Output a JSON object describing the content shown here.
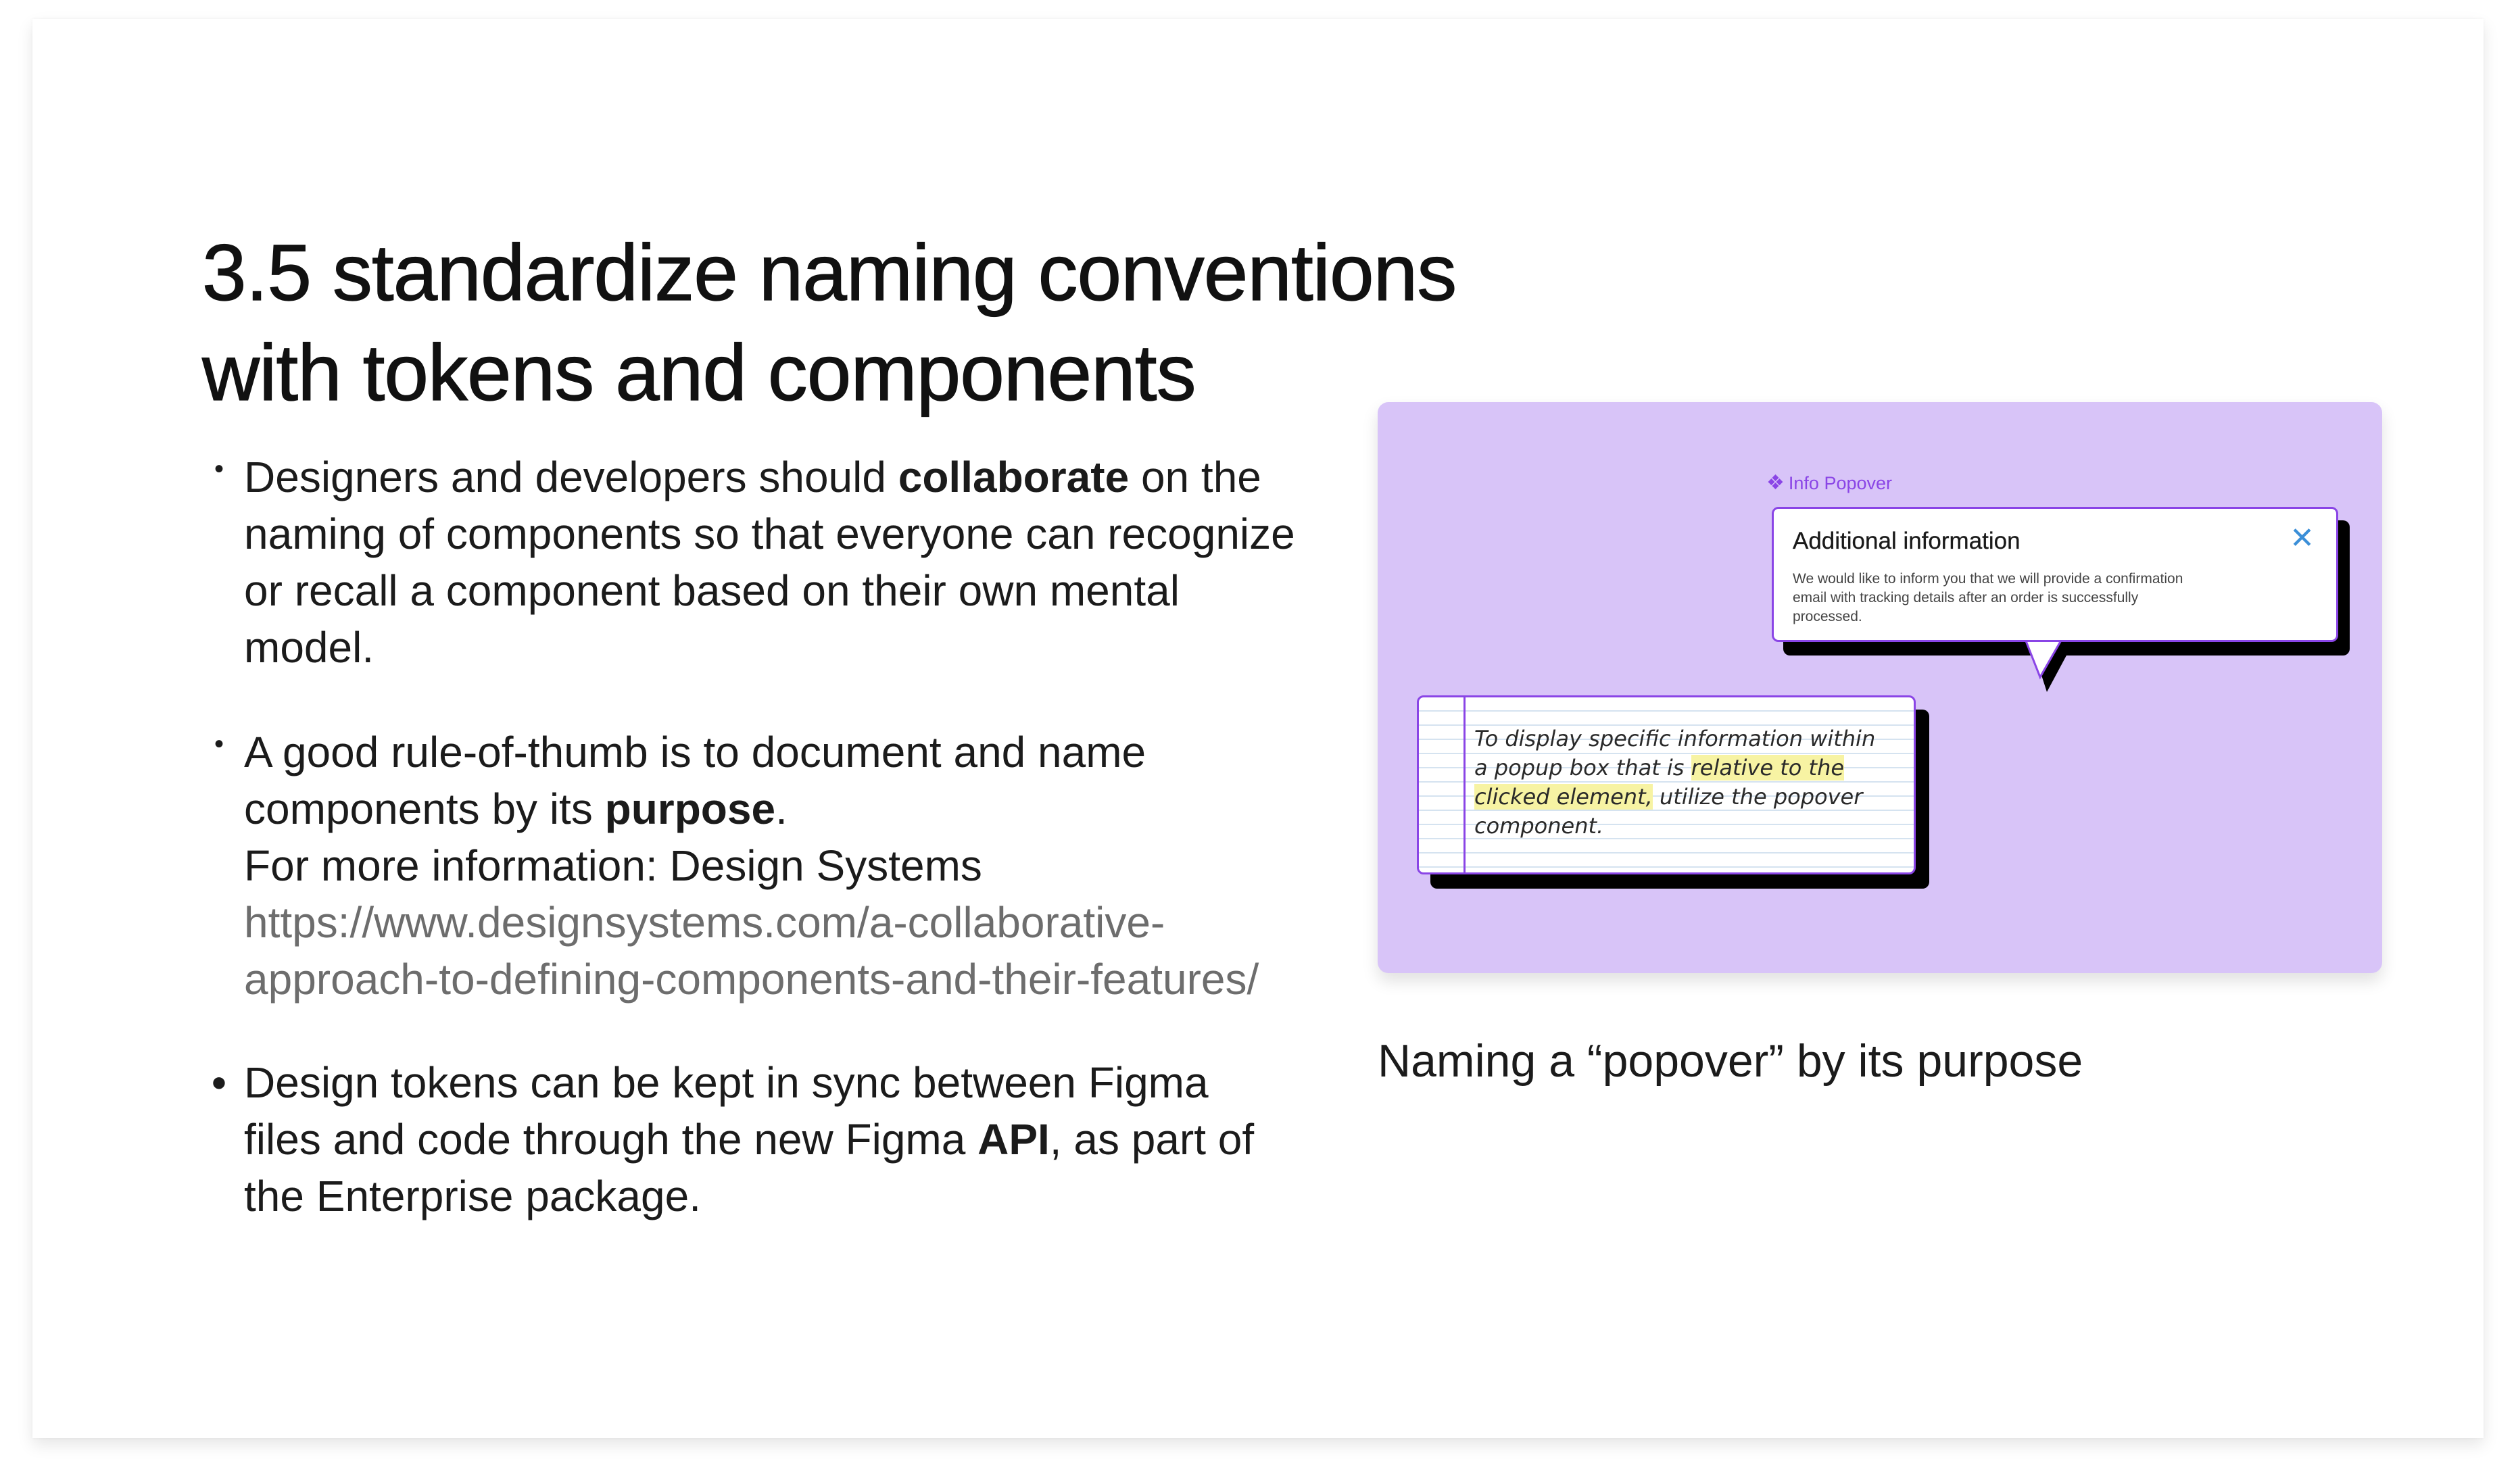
{
  "slide": {
    "title_lines": [
      "3.5 standardize naming conventions",
      "with tokens and components"
    ],
    "bullets": [
      {
        "lines": [
          [
            "Designers and developers should ",
            "collaborate",
            " on the"
          ],
          "naming of components so that everyone can recognize",
          "or recall a component based on their own mental",
          "model."
        ]
      },
      {
        "lines": [
          "A good rule-of-thumb is to document and name",
          [
            "components by its ",
            "purpose",
            "."
          ],
          "For more information: Design Systems"
        ],
        "link_lines": [
          "https://www.designsystems.com/a-collaborative-",
          "approach-to-defining-components-and-their-features/"
        ]
      },
      {
        "lines": [
          "Design tokens can be kept in sync between Figma",
          [
            "files and code through the new Figma ",
            "API",
            ", as part of"
          ],
          "the Enterprise package."
        ]
      }
    ],
    "bullet_glyphs": [
      "•",
      "•",
      "•"
    ]
  },
  "illustration": {
    "component_icon": "❖",
    "component_label": "Info Popover",
    "popover": {
      "title": "Additional information",
      "close_glyph": "✕",
      "body_lines": [
        "We would like to inform you that we will provide a confirmation",
        "email with tracking details after an order is successfully",
        "processed."
      ]
    },
    "note": {
      "line1": "To display specific information within",
      "line2_pre": "a popup box that is ",
      "line2_hl": "relative to the",
      "line3_hl": "clicked element,",
      "line3_post": " utilize the popover",
      "line4": "component."
    },
    "colors": {
      "card_bg": "#d8c4f8",
      "accent_purple": "#8a45e6",
      "close_blue": "#3b8fd8",
      "highlight": "#f7f3a3"
    }
  },
  "caption": "Naming a “popover” by its purpose"
}
